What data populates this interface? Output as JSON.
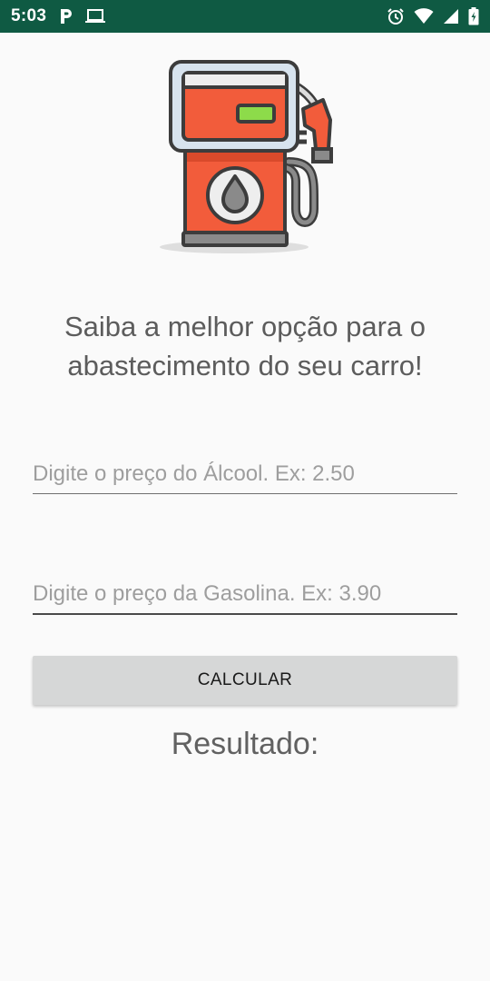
{
  "status_bar": {
    "time": "5:03",
    "background_color": "#0f5a43",
    "left_icons": [
      "parking-icon",
      "laptop-icon"
    ],
    "right_icons": [
      "alarm-icon",
      "wifi-icon",
      "signal-icon",
      "battery-icon"
    ]
  },
  "illustration": {
    "icon": "fuel-pump-icon"
  },
  "headline": "Saiba a melhor opção para o abastecimento do seu carro!",
  "inputs": {
    "alcool": {
      "value": "",
      "placeholder": "Digite o preço do Álcool. Ex: 2.50"
    },
    "gasolina": {
      "value": "",
      "placeholder": "Digite o preço da Gasolina. Ex: 3.90"
    }
  },
  "button": {
    "label": "CALCULAR"
  },
  "result": {
    "label": "Resultado:"
  }
}
